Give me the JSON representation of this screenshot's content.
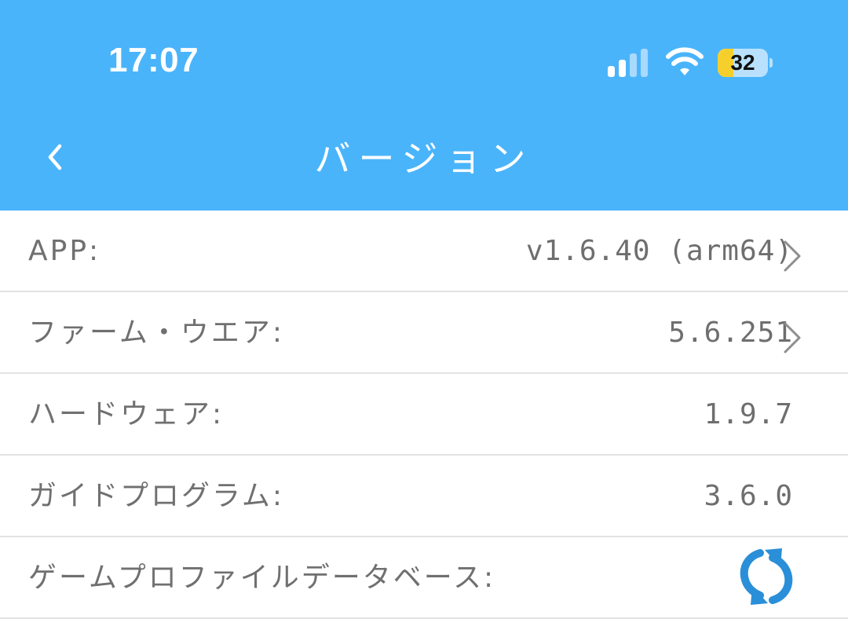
{
  "status_bar": {
    "time": "17:07",
    "battery_level": "32",
    "battery_fraction": 0.32,
    "icons": [
      "cellular-signal-icon",
      "wifi-icon",
      "battery-icon"
    ]
  },
  "header": {
    "title": "バージョン",
    "back_icon": "chevron-left-icon",
    "background_color": "#4ab4fb"
  },
  "rows": [
    {
      "label": "APP:",
      "value": "v1.6.40 (arm64)",
      "has_chevron": true
    },
    {
      "label": "ファーム・ウエア:",
      "value": "5.6.251",
      "has_chevron": true
    },
    {
      "label": "ハードウェア:",
      "value": "1.9.7",
      "has_chevron": false
    },
    {
      "label": "ガイドプログラム:",
      "value": "3.6.0",
      "has_chevron": false
    },
    {
      "label": "ゲームプロファイルデータベース:",
      "value": "",
      "action_icon": "refresh-icon"
    }
  ],
  "colors": {
    "accent": "#2a8fd8",
    "text": "#707070",
    "divider": "#e3e3e3"
  }
}
